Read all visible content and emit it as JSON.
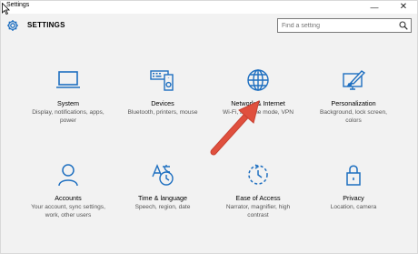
{
  "window": {
    "title": "Settings",
    "minimize_glyph": "—",
    "close_glyph": "✕"
  },
  "header": {
    "title": "SETTINGS",
    "search_placeholder": "Find a setting"
  },
  "tiles": [
    {
      "label": "System",
      "desc": "Display, notifications, apps, power",
      "icon": "laptop-icon"
    },
    {
      "label": "Devices",
      "desc": "Bluetooth, printers, mouse",
      "icon": "keyboard-speaker-icon"
    },
    {
      "label": "Network & Internet",
      "desc": "Wi-Fi, airplane mode, VPN",
      "icon": "globe-icon"
    },
    {
      "label": "Personalization",
      "desc": "Background, lock screen, colors",
      "icon": "paint-brush-icon"
    },
    {
      "label": "Accounts",
      "desc": "Your account, sync settings, work, other users",
      "icon": "person-icon"
    },
    {
      "label": "Time & language",
      "desc": "Speech, region, date",
      "icon": "time-language-icon"
    },
    {
      "label": "Ease of Access",
      "desc": "Narrator, magnifier, high contrast",
      "icon": "ease-of-access-icon"
    },
    {
      "label": "Privacy",
      "desc": "Location, camera",
      "icon": "lock-icon"
    }
  ],
  "colors": {
    "accent": "#1e6fc0",
    "arrow": "#e0503e",
    "background": "#f2f2f2"
  }
}
